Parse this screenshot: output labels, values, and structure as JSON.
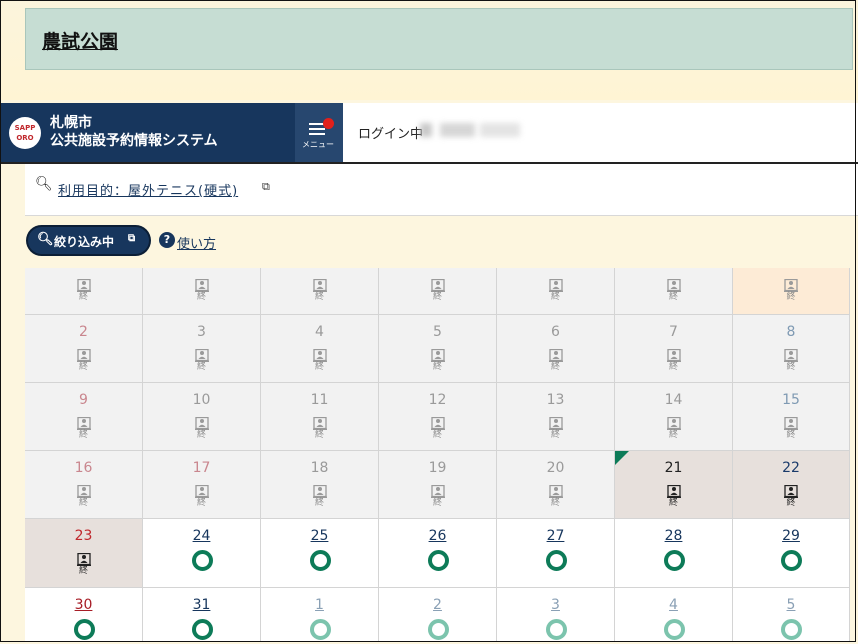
{
  "facility": {
    "name": "農試公園"
  },
  "header": {
    "logo_text": "SAPP\nORO",
    "city": "札幌市",
    "system": "公共施設予約情報システム",
    "menu_label": "メニュー",
    "login_label": "ログイン中"
  },
  "purpose": {
    "label": "利用目的：屋外テニス(硬式)"
  },
  "filter": {
    "label": "絞り込み中",
    "help_label": "使い方"
  },
  "status_labels": {
    "closed": "終"
  },
  "colors": {
    "navy": "#17365d",
    "green": "#0d7b58",
    "light_green": "#7cc4ad",
    "red_dot": "#e1201b"
  },
  "calendar": {
    "rows": [
      [
        {
          "day": "",
          "state": "past"
        },
        {
          "day": "",
          "state": "past"
        },
        {
          "day": "",
          "state": "past"
        },
        {
          "day": "",
          "state": "past"
        },
        {
          "day": "",
          "state": "past"
        },
        {
          "day": "",
          "state": "past"
        },
        {
          "day": "",
          "state": "today"
        }
      ],
      [
        {
          "day": "2",
          "state": "past",
          "kind": "sun"
        },
        {
          "day": "3",
          "state": "past"
        },
        {
          "day": "4",
          "state": "past"
        },
        {
          "day": "5",
          "state": "past"
        },
        {
          "day": "6",
          "state": "past"
        },
        {
          "day": "7",
          "state": "past"
        },
        {
          "day": "8",
          "state": "past",
          "kind": "sat"
        }
      ],
      [
        {
          "day": "9",
          "state": "past",
          "kind": "sun"
        },
        {
          "day": "10",
          "state": "past"
        },
        {
          "day": "11",
          "state": "past"
        },
        {
          "day": "12",
          "state": "past"
        },
        {
          "day": "13",
          "state": "past"
        },
        {
          "day": "14",
          "state": "past"
        },
        {
          "day": "15",
          "state": "past",
          "kind": "sat"
        }
      ],
      [
        {
          "day": "16",
          "state": "past",
          "kind": "sun"
        },
        {
          "day": "17",
          "state": "past",
          "kind": "sun"
        },
        {
          "day": "18",
          "state": "past"
        },
        {
          "day": "19",
          "state": "past"
        },
        {
          "day": "20",
          "state": "past"
        },
        {
          "day": "21",
          "state": "closed",
          "marker": true
        },
        {
          "day": "22",
          "state": "closed",
          "kind": "sat"
        }
      ],
      [
        {
          "day": "23",
          "state": "closed",
          "kind": "sun"
        },
        {
          "day": "24",
          "state": "open"
        },
        {
          "day": "25",
          "state": "open"
        },
        {
          "day": "26",
          "state": "open"
        },
        {
          "day": "27",
          "state": "open"
        },
        {
          "day": "28",
          "state": "open"
        },
        {
          "day": "29",
          "state": "open"
        }
      ],
      [
        {
          "day": "30",
          "state": "open",
          "kind": "sun"
        },
        {
          "day": "31",
          "state": "open"
        },
        {
          "day": "1",
          "state": "open",
          "kind": "next"
        },
        {
          "day": "2",
          "state": "open",
          "kind": "next"
        },
        {
          "day": "3",
          "state": "open",
          "kind": "next"
        },
        {
          "day": "4",
          "state": "open",
          "kind": "next"
        },
        {
          "day": "5",
          "state": "open",
          "kind": "next"
        }
      ]
    ]
  }
}
